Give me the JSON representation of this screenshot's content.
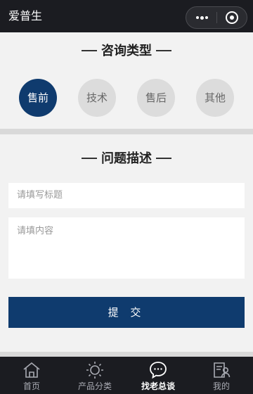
{
  "app": {
    "title": "爱普生"
  },
  "capsule": {
    "more_icon": "more-dots-icon",
    "close_icon": "close-target-icon"
  },
  "consult": {
    "heading": "咨询类型",
    "types": [
      {
        "label": "售前",
        "active": true
      },
      {
        "label": "技术",
        "active": false
      },
      {
        "label": "售后",
        "active": false
      },
      {
        "label": "其他",
        "active": false
      }
    ]
  },
  "problem": {
    "heading": "问题描述",
    "title_placeholder": "请填写标题",
    "content_placeholder": "请填内容",
    "submit_label": "提 交"
  },
  "tabbar": {
    "items": [
      {
        "label": "首页",
        "icon": "home-icon",
        "active": false
      },
      {
        "label": "产品分类",
        "icon": "sun-icon",
        "active": false
      },
      {
        "label": "找老总谈",
        "icon": "chat-icon",
        "active": true
      },
      {
        "label": "我的",
        "icon": "profile-icon",
        "active": false
      }
    ]
  },
  "colors": {
    "primary": "#0f3b6e",
    "bar": "#1b1c21",
    "inactive_type": "#dcdcdc"
  }
}
